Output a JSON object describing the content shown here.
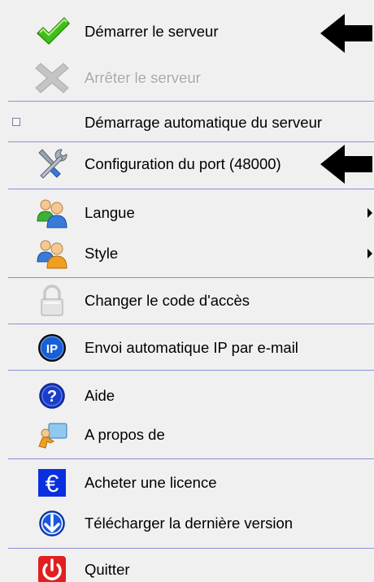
{
  "menu": {
    "items": [
      {
        "label": "Démarrer le serveur",
        "icon": "green-checkmark-icon",
        "enabled": true
      },
      {
        "label": "Arrêter le serveur",
        "icon": "grey-cross-icon",
        "enabled": false
      },
      {
        "label": "Démarrage automatique du serveur",
        "icon": "checkbox",
        "enabled": true,
        "checked": false
      },
      {
        "label": "Configuration du port (48000)",
        "icon": "tools-icon",
        "enabled": true
      },
      {
        "label": "Langue",
        "icon": "users-language-icon",
        "enabled": true,
        "submenu": true
      },
      {
        "label": "Style",
        "icon": "users-style-icon",
        "enabled": true,
        "submenu": true
      },
      {
        "label": "Changer le code d'accès",
        "icon": "padlock-icon",
        "enabled": true
      },
      {
        "label": "Envoi automatique IP par e-mail",
        "icon": "ip-icon",
        "enabled": true
      },
      {
        "label": "Aide",
        "icon": "help-icon",
        "enabled": true
      },
      {
        "label": "A propos de",
        "icon": "about-icon",
        "enabled": true
      },
      {
        "label": "Acheter une licence",
        "icon": "euro-icon",
        "enabled": true
      },
      {
        "label": "Télécharger la dernière version",
        "icon": "download-icon",
        "enabled": true
      },
      {
        "label": "Quitter",
        "icon": "power-icon",
        "enabled": true
      }
    ],
    "ip_icon_text": "IP",
    "euro_icon_text": "€",
    "help_icon_text": "?"
  },
  "colors": {
    "background": "#f0f0f0",
    "separator": "#8a8fd8",
    "disabled_text": "#a8a8a8",
    "checkmark_green": "#3fbf1a",
    "ip_blue": "#1860d8",
    "euro_blue": "#0a2fe0",
    "power_red": "#e02020"
  }
}
